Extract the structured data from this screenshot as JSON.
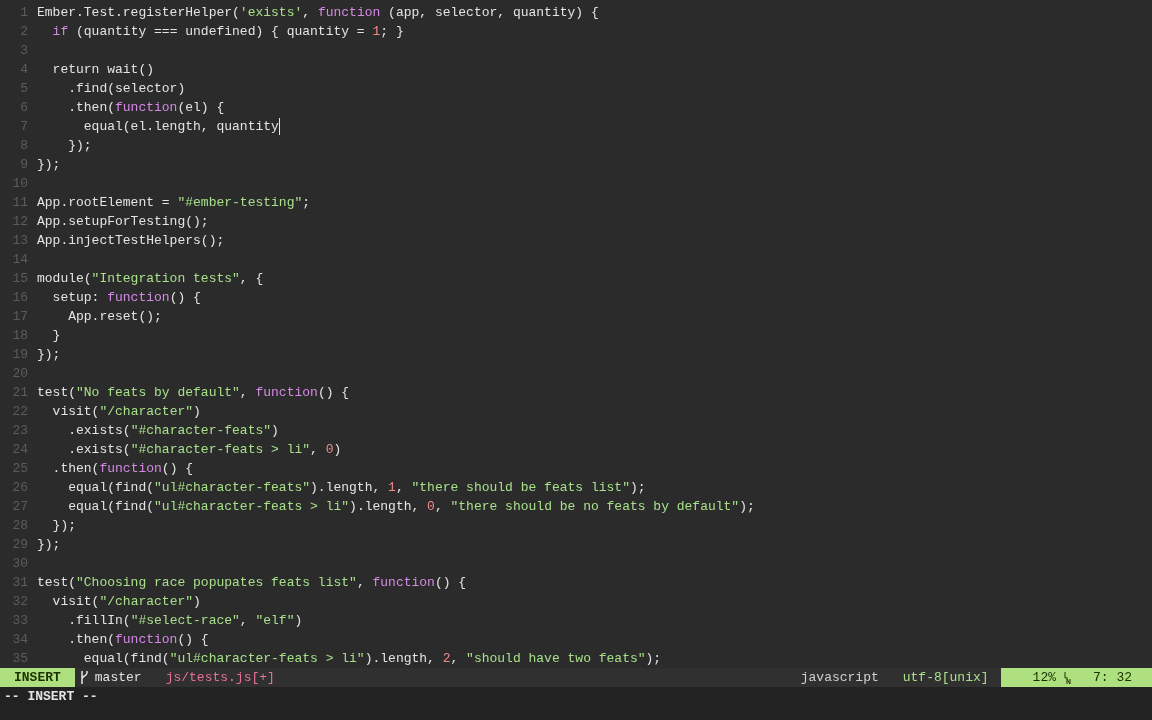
{
  "editor": {
    "lines": [
      {
        "number": "1",
        "cursor": false,
        "tokens": [
          {
            "kind": "plain",
            "text": "Ember.Test.registerHelper("
          },
          {
            "kind": "string",
            "text": "'exists'"
          },
          {
            "kind": "plain",
            "text": ", "
          },
          {
            "kind": "keyword",
            "text": "function"
          },
          {
            "kind": "plain",
            "text": " (app, selector, quantity) {"
          }
        ]
      },
      {
        "number": "2",
        "cursor": false,
        "tokens": [
          {
            "kind": "keyword",
            "text": "  if"
          },
          {
            "kind": "plain",
            "text": " (quantity === undefined) { quantity = "
          },
          {
            "kind": "number",
            "text": "1"
          },
          {
            "kind": "plain",
            "text": "; }"
          }
        ]
      },
      {
        "number": "3",
        "cursor": false
      },
      {
        "number": "4",
        "cursor": false,
        "tokens": [
          {
            "kind": "plain",
            "text": "  return wait()"
          }
        ]
      },
      {
        "number": "5",
        "cursor": false,
        "tokens": [
          {
            "kind": "plain",
            "text": "    .find(selector)"
          }
        ]
      },
      {
        "number": "6",
        "cursor": false,
        "tokens": [
          {
            "kind": "plain",
            "text": "    .then("
          },
          {
            "kind": "keyword",
            "text": "function"
          },
          {
            "kind": "plain",
            "text": "(el) {"
          }
        ]
      },
      {
        "number": "7",
        "cursor": true,
        "tokens": [
          {
            "kind": "plain",
            "text": "      equal(el.length, quantity"
          }
        ]
      },
      {
        "number": "8",
        "cursor": false,
        "tokens": [
          {
            "kind": "plain",
            "text": "    });"
          }
        ]
      },
      {
        "number": "9",
        "cursor": false,
        "tokens": [
          {
            "kind": "plain",
            "text": "});"
          }
        ]
      },
      {
        "number": "10",
        "cursor": false
      },
      {
        "number": "11",
        "cursor": false,
        "tokens": [
          {
            "kind": "plain",
            "text": "App.rootElement = "
          },
          {
            "kind": "string",
            "text": "\"#ember-testing\""
          },
          {
            "kind": "plain",
            "text": ";"
          }
        ]
      },
      {
        "number": "12",
        "cursor": false,
        "tokens": [
          {
            "kind": "plain",
            "text": "App.setupForTesting();"
          }
        ]
      },
      {
        "number": "13",
        "cursor": false,
        "tokens": [
          {
            "kind": "plain",
            "text": "App.injectTestHelpers();"
          }
        ]
      },
      {
        "number": "14",
        "cursor": false
      },
      {
        "number": "15",
        "cursor": false,
        "tokens": [
          {
            "kind": "plain",
            "text": "module("
          },
          {
            "kind": "string",
            "text": "\"Integration tests\""
          },
          {
            "kind": "plain",
            "text": ", {"
          }
        ]
      },
      {
        "number": "16",
        "cursor": false,
        "tokens": [
          {
            "kind": "plain",
            "text": "  setup: "
          },
          {
            "kind": "keyword",
            "text": "function"
          },
          {
            "kind": "plain",
            "text": "() {"
          }
        ]
      },
      {
        "number": "17",
        "cursor": false,
        "tokens": [
          {
            "kind": "plain",
            "text": "    App.reset();"
          }
        ]
      },
      {
        "number": "18",
        "cursor": false,
        "tokens": [
          {
            "kind": "plain",
            "text": "  }"
          }
        ]
      },
      {
        "number": "19",
        "cursor": false,
        "tokens": [
          {
            "kind": "plain",
            "text": "});"
          }
        ]
      },
      {
        "number": "20",
        "cursor": false
      },
      {
        "number": "21",
        "cursor": false,
        "tokens": [
          {
            "kind": "plain",
            "text": "test("
          },
          {
            "kind": "string",
            "text": "\"No feats by default\""
          },
          {
            "kind": "plain",
            "text": ", "
          },
          {
            "kind": "keyword",
            "text": "function"
          },
          {
            "kind": "plain",
            "text": "() {"
          }
        ]
      },
      {
        "number": "22",
        "cursor": false,
        "tokens": [
          {
            "kind": "plain",
            "text": "  visit("
          },
          {
            "kind": "string",
            "text": "\"/character\""
          },
          {
            "kind": "plain",
            "text": ")"
          }
        ]
      },
      {
        "number": "23",
        "cursor": false,
        "tokens": [
          {
            "kind": "plain",
            "text": "    .exists("
          },
          {
            "kind": "string",
            "text": "\"#character-feats\""
          },
          {
            "kind": "plain",
            "text": ")"
          }
        ]
      },
      {
        "number": "24",
        "cursor": false,
        "tokens": [
          {
            "kind": "plain",
            "text": "    .exists("
          },
          {
            "kind": "string",
            "text": "\"#character-feats > li\""
          },
          {
            "kind": "plain",
            "text": ", "
          },
          {
            "kind": "number",
            "text": "0"
          },
          {
            "kind": "plain",
            "text": ")"
          }
        ]
      },
      {
        "number": "25",
        "cursor": false,
        "tokens": [
          {
            "kind": "plain",
            "text": "  .then("
          },
          {
            "kind": "keyword",
            "text": "function"
          },
          {
            "kind": "plain",
            "text": "() {"
          }
        ]
      },
      {
        "number": "26",
        "cursor": false,
        "tokens": [
          {
            "kind": "plain",
            "text": "    equal(find("
          },
          {
            "kind": "string",
            "text": "\"ul#character-feats\""
          },
          {
            "kind": "plain",
            "text": ").length, "
          },
          {
            "kind": "number",
            "text": "1"
          },
          {
            "kind": "plain",
            "text": ", "
          },
          {
            "kind": "string",
            "text": "\"there should be feats list\""
          },
          {
            "kind": "plain",
            "text": ");"
          }
        ]
      },
      {
        "number": "27",
        "cursor": false,
        "tokens": [
          {
            "kind": "plain",
            "text": "    equal(find("
          },
          {
            "kind": "string",
            "text": "\"ul#character-feats > li\""
          },
          {
            "kind": "plain",
            "text": ").length, "
          },
          {
            "kind": "number",
            "text": "0"
          },
          {
            "kind": "plain",
            "text": ", "
          },
          {
            "kind": "string",
            "text": "\"there should be no feats by default\""
          },
          {
            "kind": "plain",
            "text": ");"
          }
        ]
      },
      {
        "number": "28",
        "cursor": false,
        "tokens": [
          {
            "kind": "plain",
            "text": "  });"
          }
        ]
      },
      {
        "number": "29",
        "cursor": false,
        "tokens": [
          {
            "kind": "plain",
            "text": "});"
          }
        ]
      },
      {
        "number": "30",
        "cursor": false
      },
      {
        "number": "31",
        "cursor": false,
        "tokens": [
          {
            "kind": "plain",
            "text": "test("
          },
          {
            "kind": "string",
            "text": "\"Choosing race popupates feats list\""
          },
          {
            "kind": "plain",
            "text": ", "
          },
          {
            "kind": "keyword",
            "text": "function"
          },
          {
            "kind": "plain",
            "text": "() {"
          }
        ]
      },
      {
        "number": "32",
        "cursor": false,
        "tokens": [
          {
            "kind": "plain",
            "text": "  visit("
          },
          {
            "kind": "string",
            "text": "\"/character\""
          },
          {
            "kind": "plain",
            "text": ")"
          }
        ]
      },
      {
        "number": "33",
        "cursor": false,
        "tokens": [
          {
            "kind": "plain",
            "text": "    .fillIn("
          },
          {
            "kind": "string",
            "text": "\"#select-race\""
          },
          {
            "kind": "plain",
            "text": ", "
          },
          {
            "kind": "string",
            "text": "\"elf\""
          },
          {
            "kind": "plain",
            "text": ")"
          }
        ]
      },
      {
        "number": "34",
        "cursor": false,
        "tokens": [
          {
            "kind": "plain",
            "text": "    .then("
          },
          {
            "kind": "keyword",
            "text": "function"
          },
          {
            "kind": "plain",
            "text": "() {"
          }
        ]
      },
      {
        "number": "35",
        "cursor": false,
        "tokens": [
          {
            "kind": "plain",
            "text": "      equal(find("
          },
          {
            "kind": "string",
            "text": "\"ul#character-feats > li\""
          },
          {
            "kind": "plain",
            "text": ").length, "
          },
          {
            "kind": "number",
            "text": "2"
          },
          {
            "kind": "plain",
            "text": ", "
          },
          {
            "kind": "string",
            "text": "\"should have two feats\""
          },
          {
            "kind": "plain",
            "text": ");"
          }
        ]
      }
    ]
  },
  "status_line": {
    "mode": {
      "kind": "insert",
      "text": "INSERT"
    },
    "branch": "master",
    "file": "js/tests.js[+]",
    "filetype": "javascript",
    "encoding": "utf-8[unix]",
    "percent": "12%",
    "position": "7: 32"
  },
  "command_line": "-- INSERT --"
}
